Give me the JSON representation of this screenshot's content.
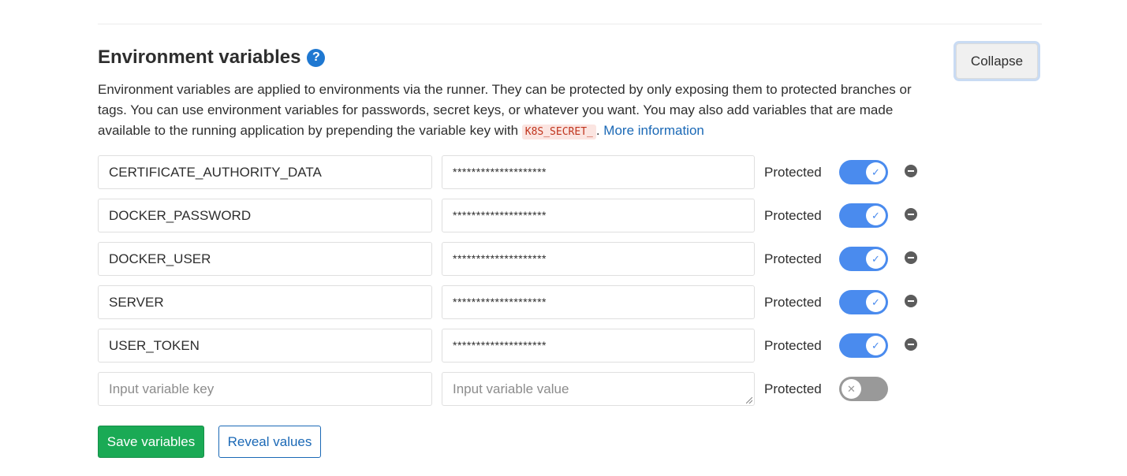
{
  "section": {
    "title": "Environment variables",
    "collapse_label": "Collapse",
    "description_1": "Environment variables are applied to environments via the runner. They can be protected by only exposing them to protected branches or tags. You can use environment variables for passwords, secret keys, or whatever you want. You may also add variables that are made available to the running application by prepending the variable key with ",
    "code_prefix": "K8S_SECRET_",
    "description_2": ". ",
    "more_info_link": "More information"
  },
  "variables": [
    {
      "key": "CERTIFICATE_AUTHORITY_DATA",
      "value": "********************",
      "protected_label": "Protected",
      "protected": true
    },
    {
      "key": "DOCKER_PASSWORD",
      "value": "********************",
      "protected_label": "Protected",
      "protected": true
    },
    {
      "key": "DOCKER_USER",
      "value": "********************",
      "protected_label": "Protected",
      "protected": true
    },
    {
      "key": "SERVER",
      "value": "********************",
      "protected_label": "Protected",
      "protected": true
    },
    {
      "key": "USER_TOKEN",
      "value": "********************",
      "protected_label": "Protected",
      "protected": true
    }
  ],
  "new_variable": {
    "key_placeholder": "Input variable key",
    "value_placeholder": "Input variable value",
    "protected_label": "Protected",
    "protected": false
  },
  "actions": {
    "save_label": "Save variables",
    "reveal_label": "Reveal values"
  },
  "colors": {
    "toggle_on": "#4a8bee",
    "toggle_off": "#999999",
    "save_green": "#1aaa55",
    "link_blue": "#1b69b6",
    "help_blue": "#1f78d1"
  },
  "icons": {
    "help": "question-circle-icon",
    "toggle_on": "check-icon",
    "toggle_off": "x-icon",
    "remove": "minus-circle-icon"
  }
}
